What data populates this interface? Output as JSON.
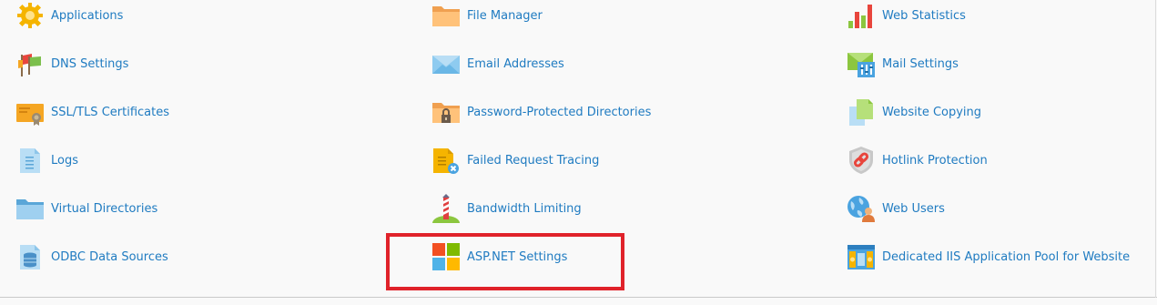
{
  "columns": [
    [
      {
        "label": "Applications",
        "icon": "applications-gear-icon"
      },
      {
        "label": "DNS Settings",
        "icon": "dns-flags-icon"
      },
      {
        "label": "SSL/TLS Certificates",
        "icon": "certificate-icon"
      },
      {
        "label": "Logs",
        "icon": "logs-document-icon"
      },
      {
        "label": "Virtual Directories",
        "icon": "folder-icon"
      },
      {
        "label": "ODBC Data Sources",
        "icon": "database-document-icon"
      }
    ],
    [
      {
        "label": "File Manager",
        "icon": "folder-icon"
      },
      {
        "label": "Email Addresses",
        "icon": "envelope-icon"
      },
      {
        "label": "Password-Protected Directories",
        "icon": "locked-folder-icon"
      },
      {
        "label": "Failed Request Tracing",
        "icon": "failed-trace-document-icon"
      },
      {
        "label": "Bandwidth Limiting",
        "icon": "bandwidth-pole-icon"
      },
      {
        "label": "ASP.NET Settings",
        "icon": "windows-logo-icon"
      }
    ],
    [
      {
        "label": "Web Statistics",
        "icon": "bar-chart-icon"
      },
      {
        "label": "Mail Settings",
        "icon": "mail-settings-icon"
      },
      {
        "label": "Website Copying",
        "icon": "copy-documents-icon"
      },
      {
        "label": "Hotlink Protection",
        "icon": "chain-shield-icon"
      },
      {
        "label": "Web Users",
        "icon": "globe-user-icon"
      },
      {
        "label": "Dedicated IIS Application Pool for Website",
        "icon": "app-pool-icon"
      }
    ]
  ],
  "highlighted_item": "ASP.NET Settings",
  "colors": {
    "link": "#1f7bc1",
    "highlight_border": "#e0222a",
    "background": "#f9f9f9"
  }
}
